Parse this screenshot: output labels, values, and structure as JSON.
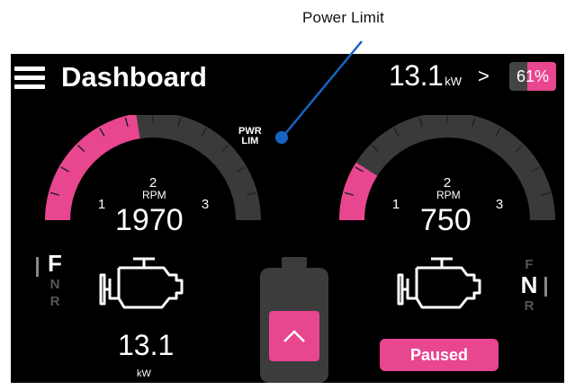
{
  "annotation": {
    "label": "Power Limit"
  },
  "header": {
    "title": "Dashboard",
    "power_value": "13.1",
    "power_unit": "kW",
    "battery_percent_text": "61%",
    "battery_level": 0.61,
    "next_icon": "chevron-right-icon",
    "menu_icon": "hamburger-menu-icon"
  },
  "power_limit_indicator": {
    "line1": "PWR",
    "line2": "LIM"
  },
  "left_motor": {
    "gauge_ticks": [
      "1",
      "2",
      "3"
    ],
    "rpm_label": "RPM",
    "rpm_value": "1970",
    "rpm_level": 0.45,
    "directions": [
      "F",
      "N",
      "R"
    ],
    "active_direction": "F",
    "power_value": "13.1",
    "power_unit": "kW",
    "icon": "engine-icon"
  },
  "right_motor": {
    "gauge_ticks": [
      "1",
      "2",
      "3"
    ],
    "rpm_label": "RPM",
    "rpm_value": "750",
    "rpm_level": 0.18,
    "directions": [
      "F",
      "N",
      "R"
    ],
    "active_direction": "N",
    "icon": "engine-icon"
  },
  "center": {
    "up_icon": "chevron-up-icon",
    "battery_icon": "battery-icon"
  },
  "status_button": {
    "label": "Paused"
  },
  "colors": {
    "accent": "#e8468f",
    "background": "#000000",
    "gauge_track": "#3a3a3a",
    "annotation_line": "#1565c0"
  }
}
